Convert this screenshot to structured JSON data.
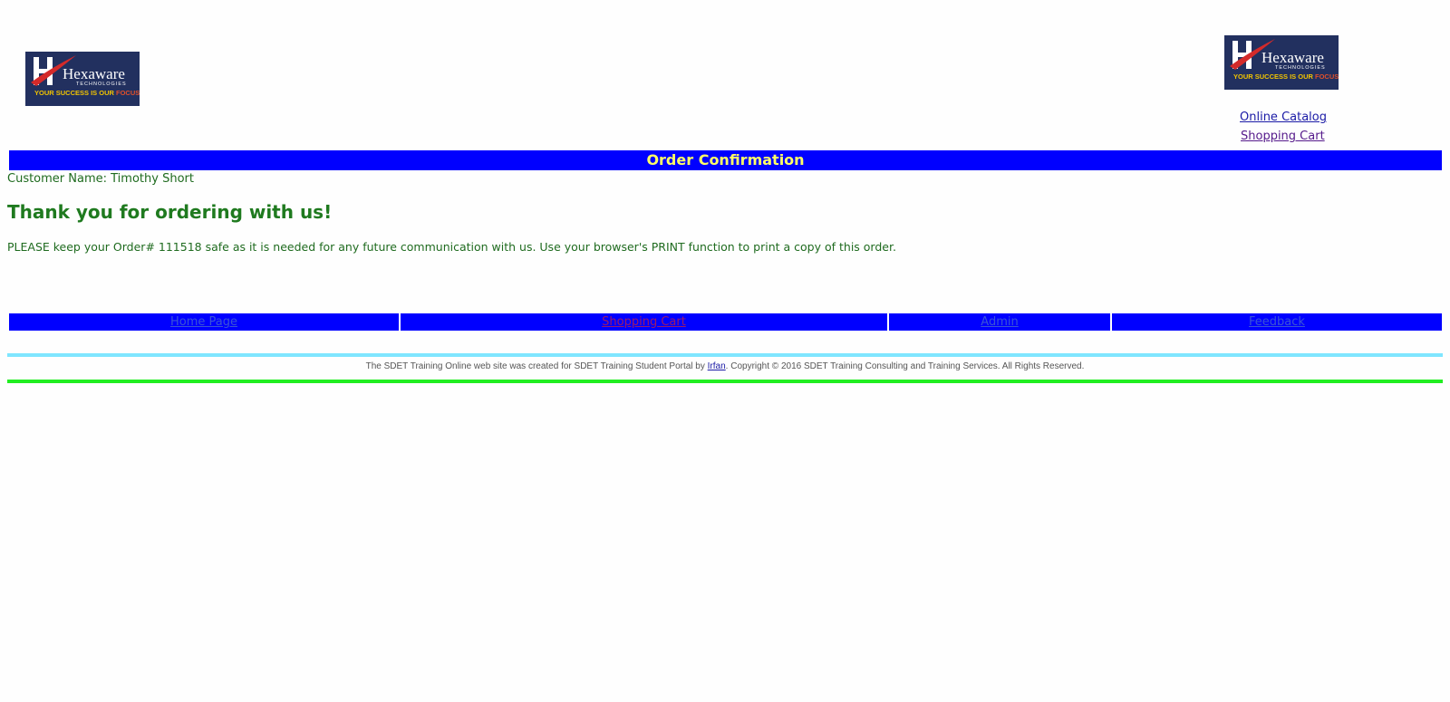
{
  "logo": {
    "brand": "Hexaware",
    "subtitle": "TECHNOLOGIES",
    "tagline_main": "YOUR SUCCESS IS OUR ",
    "tagline_accent": "FOCUS"
  },
  "top_links": {
    "catalog": "Online Catalog",
    "cart": "Shopping Cart"
  },
  "title": "Order Confirmation",
  "customer_name": "Customer Name: Timothy Short",
  "thank_you": "Thank you for ordering with us!",
  "order_message": "PLEASE keep your Order# 111518 safe as it is needed for any future communication with us. Use your browser's PRINT function to print a copy of this order.",
  "nav": {
    "home": "Home Page",
    "cart": "Shopping Cart",
    "admin": "Admin",
    "feedback": "Feedback"
  },
  "footer": {
    "prefix": "The SDET Training Online web site was created for SDET Training Student Portal by ",
    "author": "Irfan",
    "suffix": ". Copyright © 2016 SDET Training Consulting and Training Services. All Rights Reserved."
  },
  "colors": {
    "title_bar_bg": "#0000ff",
    "title_text": "#ffff66",
    "body_text": "#1f6b1f",
    "top_rule": "#7fe6ff",
    "bottom_rule": "#22ee22",
    "logo_bg": "#22305f"
  },
  "icons": {
    "logo": "hexaware-logo"
  }
}
